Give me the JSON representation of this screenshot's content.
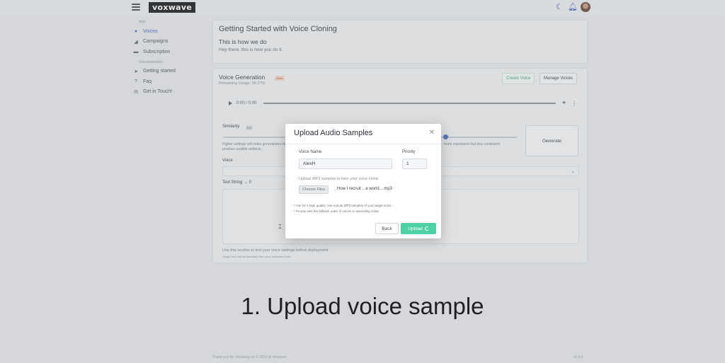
{
  "app": {
    "logo": "voxwave"
  },
  "sidebar": {
    "section_app": "App",
    "items": [
      {
        "label": "Voices",
        "icon": "mic-icon",
        "active": true
      },
      {
        "label": "Campaigns",
        "icon": "megaphone-icon"
      },
      {
        "label": "Subscription",
        "icon": "card-icon"
      }
    ],
    "section_docs": "Documentation",
    "doc_items": [
      {
        "label": "Getting started",
        "icon": "rocket-icon"
      },
      {
        "label": "Faq",
        "icon": "question-icon"
      },
      {
        "label": "Get in Touch!",
        "icon": "mail-icon"
      }
    ]
  },
  "getting_started": {
    "title": "Getting Started with Voice Cloning",
    "subtitle": "This is how we do",
    "body": "Hey there, this is how you do it."
  },
  "voice_generation": {
    "title": "Voice Generation",
    "badge": "Beta",
    "usage": "Remaining Usage: 98.27%",
    "create_voice": "Create Voice",
    "manage_voices": "Manage Voices",
    "audio_time": "0:00 / 0:00",
    "similarity_label": "Similarity",
    "similarity_value": "0.6",
    "help_left": "Higher settings will make generations may produce audible artifacts.",
    "help_right": "more expressive but less consistent",
    "generate": "Generate",
    "voice_label": "Voice",
    "text_string_label": "Text String → 0",
    "footer_note": "Use this section to test your voice settings before deployment.",
    "footer_small": "Usage here will be deducted from your character limits."
  },
  "modal": {
    "title": "Upload Audio Samples",
    "voice_name_label": "Voice Name",
    "voice_name_value": "AlexH",
    "priority_label": "Priority",
    "priority_value": "1",
    "upload_text": "Upload MP3 samples to train your voice clone.",
    "choose_files": "Choose Files",
    "file_name": "How I recruit ...e world....mp3",
    "note1": "* Aim for 5 high quality, one-minute MP3 samples of your target voice.",
    "note2": "* Priority sets the fallback order of voices in ascending order.",
    "back": "Back",
    "upload": "Upload"
  },
  "caption": "1. Upload voice sample",
  "footer": {
    "copyright": "Thank you for choosing us! © 2023 ⊕ Voxwave",
    "version": "v1.0.0"
  },
  "colors": {
    "accent": "#4b6cc2",
    "upload_button": "#4fd1a7",
    "create_voice_text": "#4aa886"
  }
}
